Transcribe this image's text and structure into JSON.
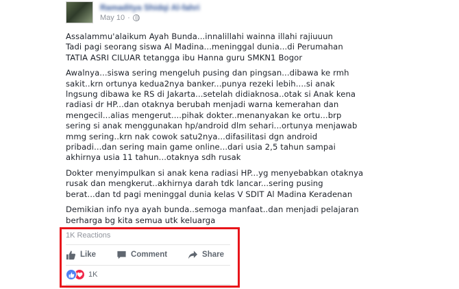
{
  "post": {
    "author": "Ramaditya Shidqi Al-fahri",
    "timestamp": "May 10",
    "dot": "·",
    "paragraphs": [
      [
        "Assalammu'alaikum Ayah Bunda...innalillahi wainna illahi rajiuuun",
        "Tadi pagi seorang siswa Al Madina...meninggal dunia...di Perumahan",
        "TATIA ASRI CILUAR tetangga ibu Hanna guru SMKN1 Bogor"
      ],
      [
        "Awalnya...siswa sering mengeluh pusing dan pingsan...dibawa ke rmh",
        "sakit..krn ortunya kedua2nya banker...punya rezeki lebih....si anak",
        "lngsung dibawa ke RS di Jakarta...setelah didiaknosa..otak si Anak kena",
        "radiasi dr HP...dan otaknya berubah menjadi warna kemerahan dan",
        "mengecil...alias mengerut....pihak dokter..menanyakan ke ortu...brp",
        "sering si anak menggunakan hp/android dlm sehari...ortunya menjawab",
        "mmg sering..krn nak cowok satu2nya...difasilitasi dgn android",
        "pribadi...dan sering main game online...dari usia 2,5 tahun sampai",
        "akhirnya usia 11 tahun...otaknya sdh rusak"
      ],
      [
        "Dokter menyimpulkan si anak kena radiasi HP...yg menyebabkan otaknya",
        "rusak dan mengkerut..akhirnya darah tdk lancar...sering pusing",
        "berat...dan td pagi meninggal dunia kelas V SDIT Al Madina Keradenan"
      ],
      [
        "Demikian info nya ayah bunda..semoga manfaat..dan menjadi pelajaran",
        "berharga bg kita semua utk keluarga"
      ]
    ]
  },
  "reactions": {
    "summary_label": "1K Reactions",
    "count": "1K",
    "icons": [
      "like-reaction-icon",
      "love-reaction-icon"
    ]
  },
  "actions": {
    "like_label": "Like",
    "comment_label": "Comment",
    "share_label": "Share"
  },
  "colors": {
    "author_link": "#365899",
    "secondary_text": "#90949c",
    "action_text": "#606770",
    "like_blue": "#4f80f2",
    "love_red": "#f0284a",
    "highlight_box": "#e8141a"
  }
}
